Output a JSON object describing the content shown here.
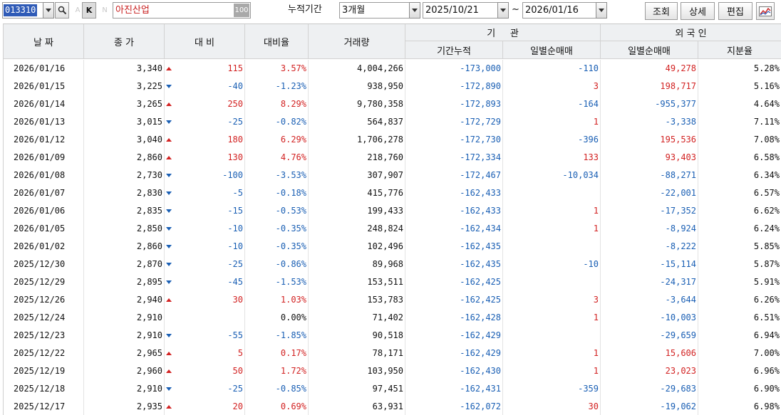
{
  "toolbar": {
    "code": "013310",
    "a_label": "A",
    "k_label": "K",
    "n_label": "N",
    "stock_name": "아진산업",
    "badge": "100",
    "period_label": "누적기간",
    "period_value": "3개월",
    "start_date": "2025/10/21",
    "tilde": "~",
    "end_date": "2026/01/16",
    "query_label": "조회",
    "detail_label": "상세",
    "edit_label": "편집",
    "chart_icon": "chart-icon",
    "colors": {
      "selection": "#2f5bb7",
      "stock_name": "#c81d1d"
    }
  },
  "grid": {
    "headers": {
      "date": "날 짜",
      "close": "종 가",
      "change": "대 비",
      "rate": "대비율",
      "volume": "거래량",
      "inst_group": "기     관",
      "inst_cum": "기간누적",
      "inst_daily": "일별순매매",
      "foreign_group": "외 국 인",
      "foreign_daily": "일별순매매",
      "foreign_share": "지분율"
    },
    "colors": {
      "up": "#d22222",
      "down": "#1a5fb4"
    },
    "rows": [
      {
        "date": "2026/01/16",
        "close": "3,340",
        "dir": "up",
        "change": "115",
        "rate": "3.57%",
        "volume": "4,004,266",
        "inst_cum": "-173,000",
        "inst_daily": "-110",
        "foreign_daily": "49,278",
        "share": "5.28%"
      },
      {
        "date": "2026/01/15",
        "close": "3,225",
        "dir": "down",
        "change": "-40",
        "rate": "-1.23%",
        "volume": "938,950",
        "inst_cum": "-172,890",
        "inst_daily": "3",
        "foreign_daily": "198,717",
        "share": "5.16%"
      },
      {
        "date": "2026/01/14",
        "close": "3,265",
        "dir": "up",
        "change": "250",
        "rate": "8.29%",
        "volume": "9,780,358",
        "inst_cum": "-172,893",
        "inst_daily": "-164",
        "foreign_daily": "-955,377",
        "share": "4.64%"
      },
      {
        "date": "2026/01/13",
        "close": "3,015",
        "dir": "down",
        "change": "-25",
        "rate": "-0.82%",
        "volume": "564,837",
        "inst_cum": "-172,729",
        "inst_daily": "1",
        "foreign_daily": "-3,338",
        "share": "7.11%"
      },
      {
        "date": "2026/01/12",
        "close": "3,040",
        "dir": "up",
        "change": "180",
        "rate": "6.29%",
        "volume": "1,706,278",
        "inst_cum": "-172,730",
        "inst_daily": "-396",
        "foreign_daily": "195,536",
        "share": "7.08%"
      },
      {
        "date": "2026/01/09",
        "close": "2,860",
        "dir": "up",
        "change": "130",
        "rate": "4.76%",
        "volume": "218,760",
        "inst_cum": "-172,334",
        "inst_daily": "133",
        "foreign_daily": "93,403",
        "share": "6.58%"
      },
      {
        "date": "2026/01/08",
        "close": "2,730",
        "dir": "down",
        "change": "-100",
        "rate": "-3.53%",
        "volume": "307,907",
        "inst_cum": "-172,467",
        "inst_daily": "-10,034",
        "foreign_daily": "-88,271",
        "share": "6.34%"
      },
      {
        "date": "2026/01/07",
        "close": "2,830",
        "dir": "down",
        "change": "-5",
        "rate": "-0.18%",
        "volume": "415,776",
        "inst_cum": "-162,433",
        "inst_daily": "",
        "foreign_daily": "-22,001",
        "share": "6.57%"
      },
      {
        "date": "2026/01/06",
        "close": "2,835",
        "dir": "down",
        "change": "-15",
        "rate": "-0.53%",
        "volume": "199,433",
        "inst_cum": "-162,433",
        "inst_daily": "1",
        "foreign_daily": "-17,352",
        "share": "6.62%"
      },
      {
        "date": "2026/01/05",
        "close": "2,850",
        "dir": "down",
        "change": "-10",
        "rate": "-0.35%",
        "volume": "248,824",
        "inst_cum": "-162,434",
        "inst_daily": "1",
        "foreign_daily": "-8,924",
        "share": "6.24%"
      },
      {
        "date": "2026/01/02",
        "close": "2,860",
        "dir": "down",
        "change": "-10",
        "rate": "-0.35%",
        "volume": "102,496",
        "inst_cum": "-162,435",
        "inst_daily": "",
        "foreign_daily": "-8,222",
        "share": "5.85%"
      },
      {
        "date": "2025/12/30",
        "close": "2,870",
        "dir": "down",
        "change": "-25",
        "rate": "-0.86%",
        "volume": "89,968",
        "inst_cum": "-162,435",
        "inst_daily": "-10",
        "foreign_daily": "-15,114",
        "share": "5.87%"
      },
      {
        "date": "2025/12/29",
        "close": "2,895",
        "dir": "down",
        "change": "-45",
        "rate": "-1.53%",
        "volume": "153,511",
        "inst_cum": "-162,425",
        "inst_daily": "",
        "foreign_daily": "-24,317",
        "share": "5.91%"
      },
      {
        "date": "2025/12/26",
        "close": "2,940",
        "dir": "up",
        "change": "30",
        "rate": "1.03%",
        "volume": "153,783",
        "inst_cum": "-162,425",
        "inst_daily": "3",
        "foreign_daily": "-3,644",
        "share": "6.26%"
      },
      {
        "date": "2025/12/24",
        "close": "2,910",
        "dir": "flat",
        "change": "",
        "rate": "0.00%",
        "volume": "71,402",
        "inst_cum": "-162,428",
        "inst_daily": "1",
        "foreign_daily": "-10,003",
        "share": "6.51%"
      },
      {
        "date": "2025/12/23",
        "close": "2,910",
        "dir": "down",
        "change": "-55",
        "rate": "-1.85%",
        "volume": "90,518",
        "inst_cum": "-162,429",
        "inst_daily": "",
        "foreign_daily": "-29,659",
        "share": "6.94%"
      },
      {
        "date": "2025/12/22",
        "close": "2,965",
        "dir": "up",
        "change": "5",
        "rate": "0.17%",
        "volume": "78,171",
        "inst_cum": "-162,429",
        "inst_daily": "1",
        "foreign_daily": "15,606",
        "share": "7.00%"
      },
      {
        "date": "2025/12/19",
        "close": "2,960",
        "dir": "up",
        "change": "50",
        "rate": "1.72%",
        "volume": "103,950",
        "inst_cum": "-162,430",
        "inst_daily": "1",
        "foreign_daily": "23,023",
        "share": "6.96%"
      },
      {
        "date": "2025/12/18",
        "close": "2,910",
        "dir": "down",
        "change": "-25",
        "rate": "-0.85%",
        "volume": "97,451",
        "inst_cum": "-162,431",
        "inst_daily": "-359",
        "foreign_daily": "-29,683",
        "share": "6.90%"
      },
      {
        "date": "2025/12/17",
        "close": "2,935",
        "dir": "up",
        "change": "20",
        "rate": "0.69%",
        "volume": "63,931",
        "inst_cum": "-162,072",
        "inst_daily": "30",
        "foreign_daily": "-19,062",
        "share": "6.98%"
      }
    ]
  }
}
